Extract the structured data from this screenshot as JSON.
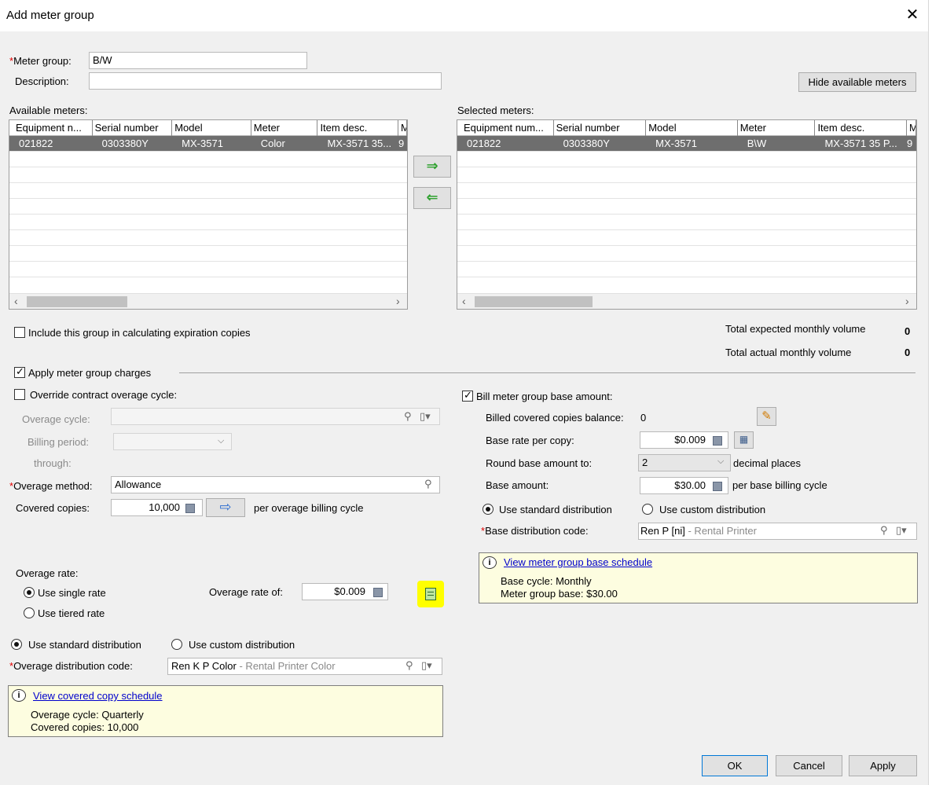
{
  "window": {
    "title": "Add meter group"
  },
  "meter_group": {
    "label": "Meter group:",
    "value": "B/W"
  },
  "description": {
    "label": "Description:",
    "value": ""
  },
  "hide_meters_button": "Hide available meters",
  "available": {
    "label": "Available meters:",
    "columns": [
      "Equipment n...",
      "Serial number",
      "Model",
      "Meter",
      "Item desc.",
      "M"
    ],
    "rows": [
      [
        "021822",
        "0303380Y",
        "MX-3571",
        "Color",
        "MX-3571 35...",
        "9"
      ]
    ]
  },
  "selected": {
    "label": "Selected meters:",
    "columns": [
      "Equipment num...",
      "Serial number",
      "Model",
      "Meter",
      "Item desc.",
      "M"
    ],
    "rows": [
      [
        "021822",
        "0303380Y",
        "MX-3571",
        "B\\W",
        "MX-3571 35 P...",
        "9"
      ]
    ]
  },
  "move_right": "⇒",
  "move_left": "⇐",
  "include_expiration": {
    "label": "Include this group in calculating expiration copies",
    "checked": false
  },
  "totals": {
    "expected_label": "Total expected monthly volume",
    "expected_value": "0",
    "actual_label": "Total actual monthly volume",
    "actual_value": "0"
  },
  "apply_charges": {
    "label": "Apply meter group charges",
    "checked": true
  },
  "override_cycle": {
    "label": "Override contract overage cycle:",
    "checked": false
  },
  "overage_cycle": {
    "label": "Overage cycle:",
    "value": ""
  },
  "billing_period": {
    "label": "Billing period:",
    "through": "through:"
  },
  "overage_method": {
    "label": "Overage method:",
    "value": "Allowance"
  },
  "covered_copies": {
    "label": "Covered copies:",
    "value": "10,000",
    "suffix": "per overage billing cycle"
  },
  "overage_rate": {
    "label": "Overage rate:",
    "single": "Use single rate",
    "tiered": "Use tiered rate",
    "rate_label": "Overage rate of:",
    "rate_value": "$0.009"
  },
  "overage_distribution": {
    "standard": "Use standard distribution",
    "custom": "Use custom distribution",
    "code_label": "Overage distribution code:",
    "code": "Ren K P Color",
    "code_desc": "- Rental Printer Color"
  },
  "covered_info": {
    "link": "View covered copy schedule",
    "line1": "Overage cycle: Quarterly",
    "line2": "Covered copies: 10,000"
  },
  "bill_base": {
    "label": "Bill meter group base amount:",
    "checked": true
  },
  "billed_balance": {
    "label": "Billed covered copies balance:",
    "value": "0"
  },
  "base_rate": {
    "label": "Base rate per copy:",
    "value": "$0.009"
  },
  "round_base": {
    "label": "Round base amount to:",
    "value": "2",
    "suffix": "decimal places"
  },
  "base_amount": {
    "label": "Base amount:",
    "value": "$30.00",
    "suffix": "per base billing cycle"
  },
  "base_distribution": {
    "standard": "Use standard distribution",
    "custom": "Use custom distribution",
    "code_label": "Base distribution code:",
    "code": "Ren P [ni]",
    "code_desc": "- Rental Printer"
  },
  "base_info": {
    "link": "View meter group base schedule",
    "line1": "Base cycle: Monthly",
    "line2": "Meter group base: $30.00"
  },
  "buttons": {
    "ok": "OK",
    "cancel": "Cancel",
    "apply": "Apply"
  },
  "colors": {
    "highlight": "#ffff00",
    "info_bg": "#fdfde0",
    "selected_row": "#6e6e6e",
    "link": "#0000cc",
    "required": "#e00000"
  }
}
